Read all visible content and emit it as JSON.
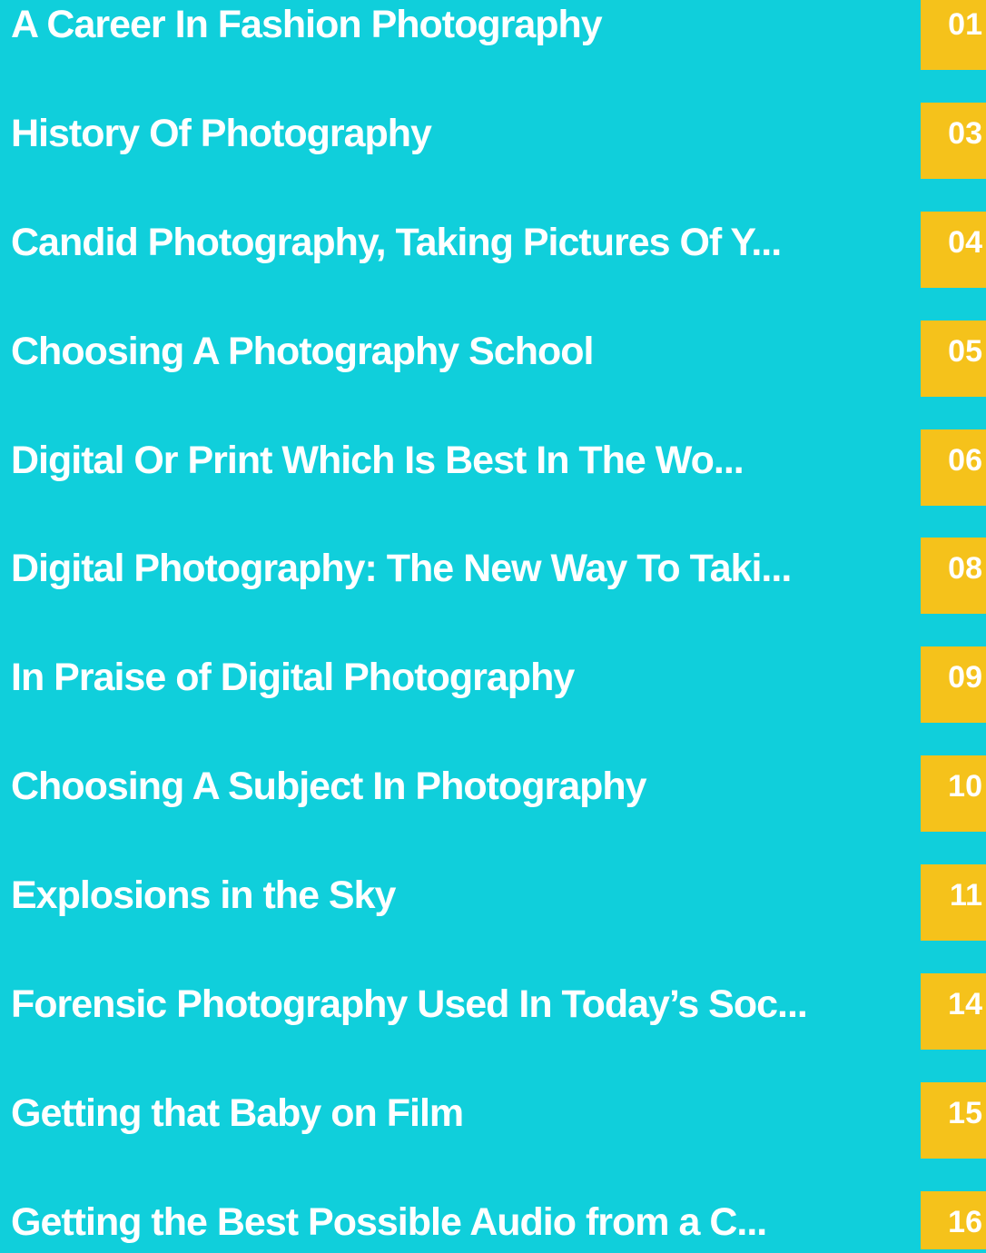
{
  "colors": {
    "background": "#10cfdb",
    "page_badge": "#f5c21b",
    "text": "#ffffff"
  },
  "toc": {
    "items": [
      {
        "title": "A Career In Fashion Photography",
        "page": "01"
      },
      {
        "title": "History Of Photography",
        "page": "03"
      },
      {
        "title": "Candid Photography, Taking Pictures Of Y...",
        "page": "04"
      },
      {
        "title": "Choosing A Photography School",
        "page": "05"
      },
      {
        "title": "Digital Or Print Which Is Best In The Wo...",
        "page": "06"
      },
      {
        "title": "Digital Photography: The New Way To Taki...",
        "page": "08"
      },
      {
        "title": "In Praise of Digital Photography",
        "page": "09"
      },
      {
        "title": "Choosing A Subject In Photography",
        "page": "10"
      },
      {
        "title": "Explosions in the Sky",
        "page": "11"
      },
      {
        "title": "Forensic Photography Used In Today’s Soc...",
        "page": "14"
      },
      {
        "title": "Getting that Baby on Film",
        "page": "15"
      },
      {
        "title": "Getting the Best Possible Audio from a C...",
        "page": "16"
      }
    ]
  }
}
